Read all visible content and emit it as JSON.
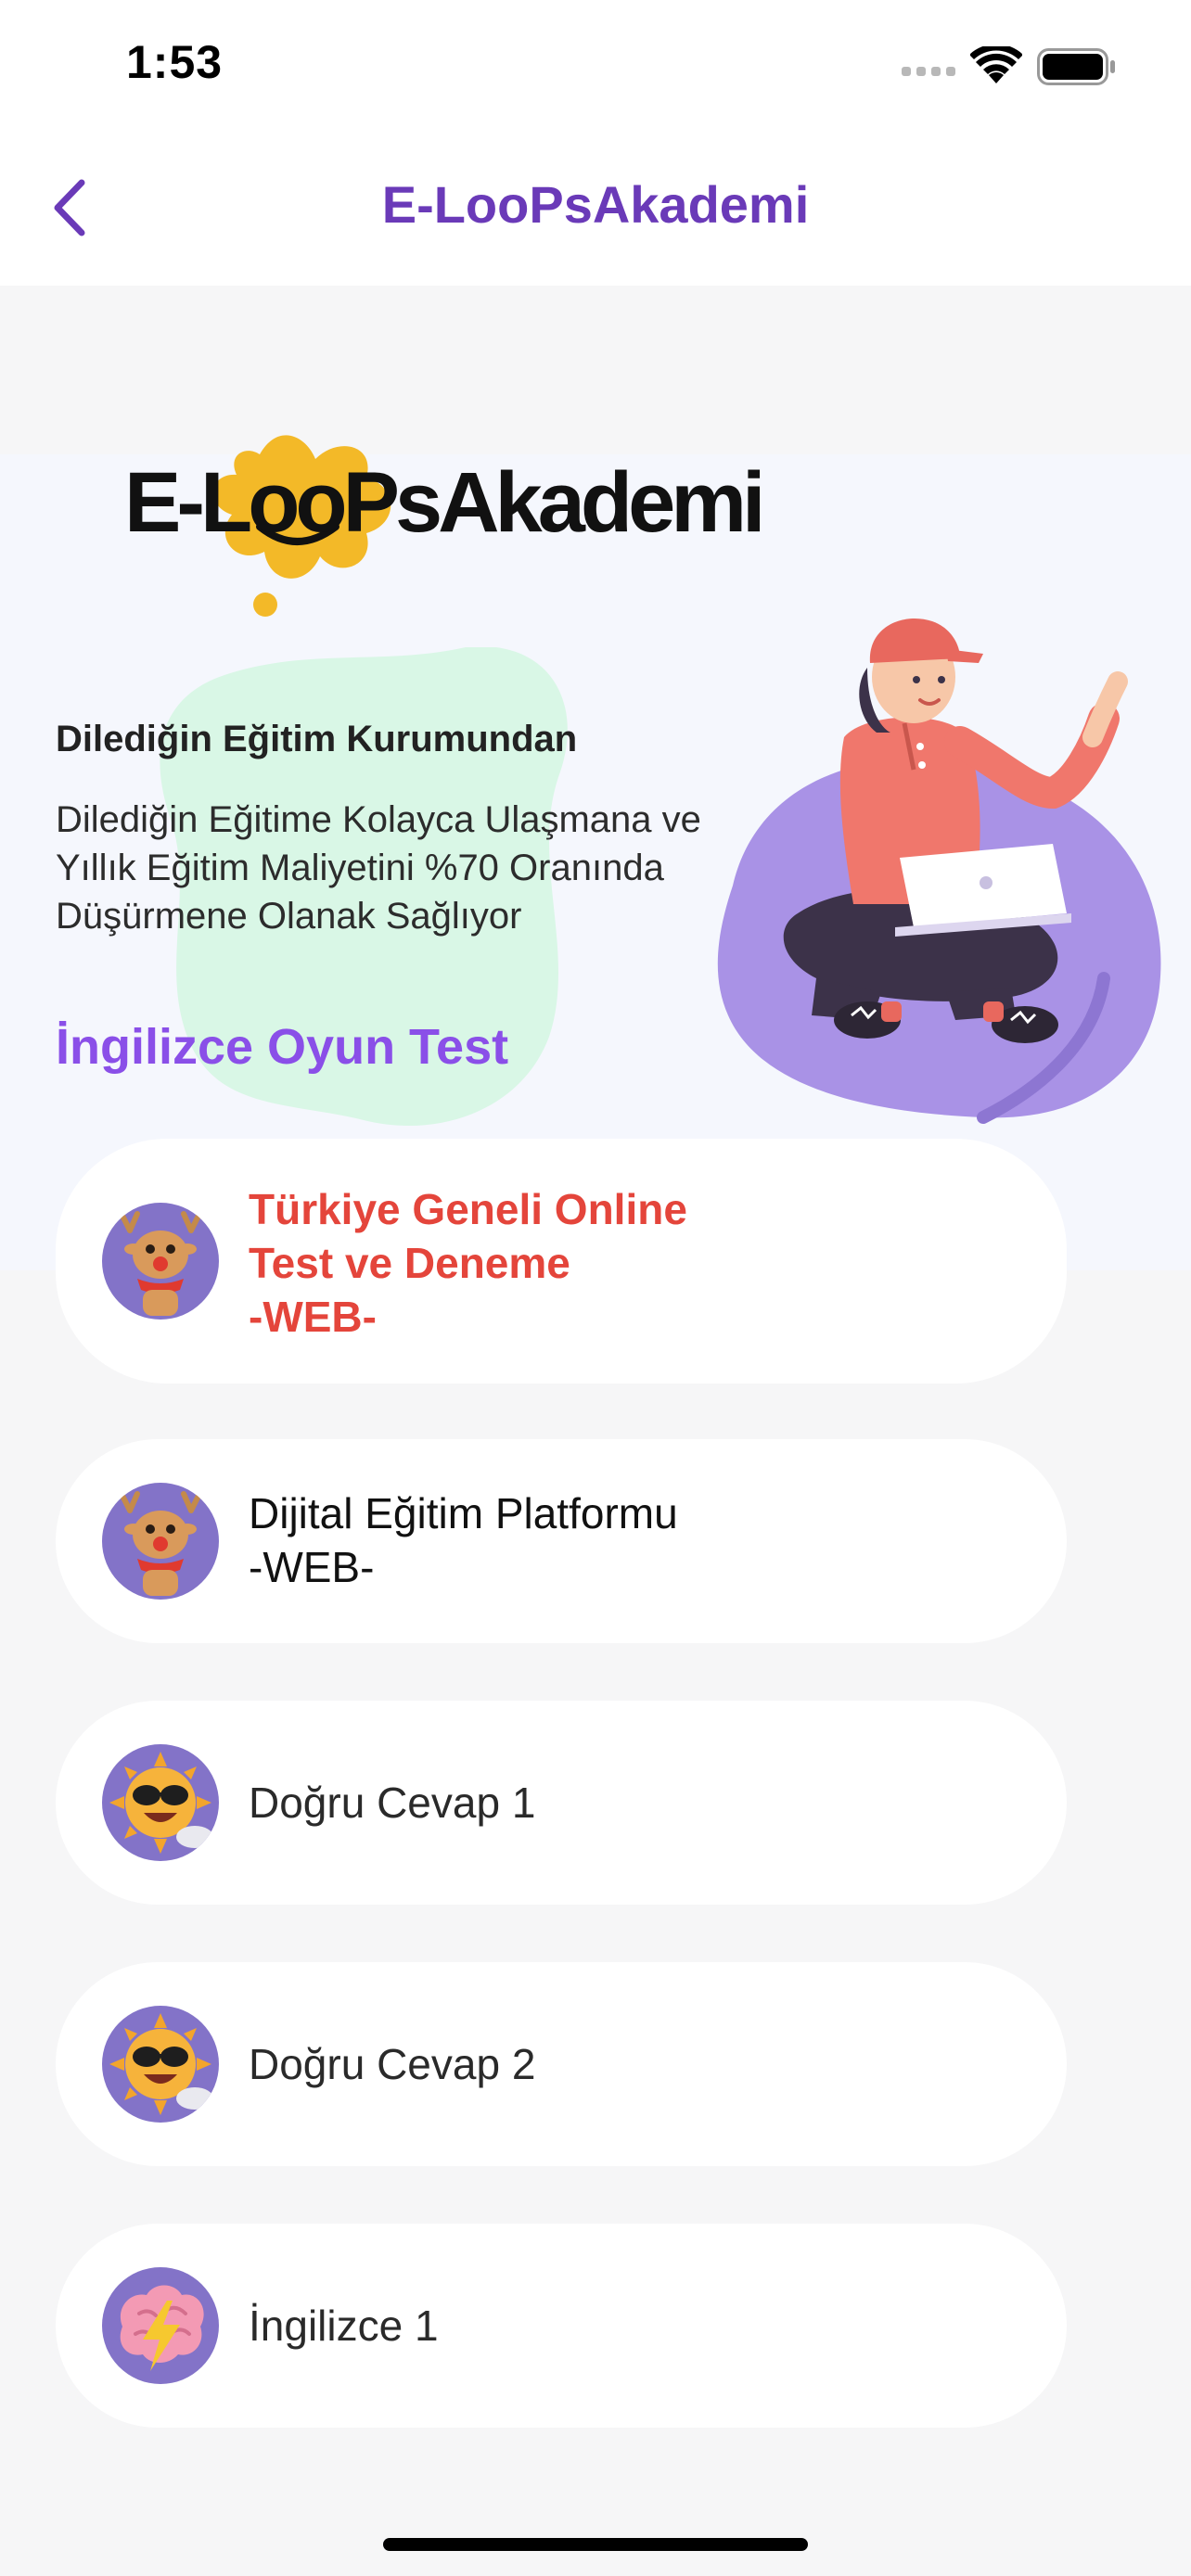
{
  "status_bar": {
    "time": "1:53"
  },
  "nav": {
    "title": "E-LooPsAkademi"
  },
  "hero": {
    "logo_text": "E-LooPsAkademi",
    "heading": "Dilediğin Eğitim Kurumundan",
    "description": "Dilediğin Eğitime Kolayca Ulaşmana ve\nYıllık Eğitim Maliyetini %70 Oranında\nDüşürmene Olanak Sağlıyor"
  },
  "section": {
    "title": "İngilizce Oyun Test"
  },
  "items": [
    {
      "label": "Türkiye Geneli Online\nTest ve Deneme\n-WEB-",
      "icon": "reindeer-icon"
    },
    {
      "label": "Dijital Eğitim Platformu\n-WEB-",
      "icon": "reindeer-icon"
    },
    {
      "label": "Doğru Cevap 1",
      "icon": "cool-sun-icon"
    },
    {
      "label": "Doğru Cevap 2",
      "icon": "cool-sun-icon"
    },
    {
      "label": "İngilizce 1",
      "icon": "brain-lightning-icon"
    }
  ],
  "colors": {
    "brand_purple": "#6a3ab8",
    "section_purple": "#8a4fe8",
    "highlight_red": "#e4453b",
    "avatar_bg": "#8373c8",
    "logo_splash": "#f3b928"
  }
}
